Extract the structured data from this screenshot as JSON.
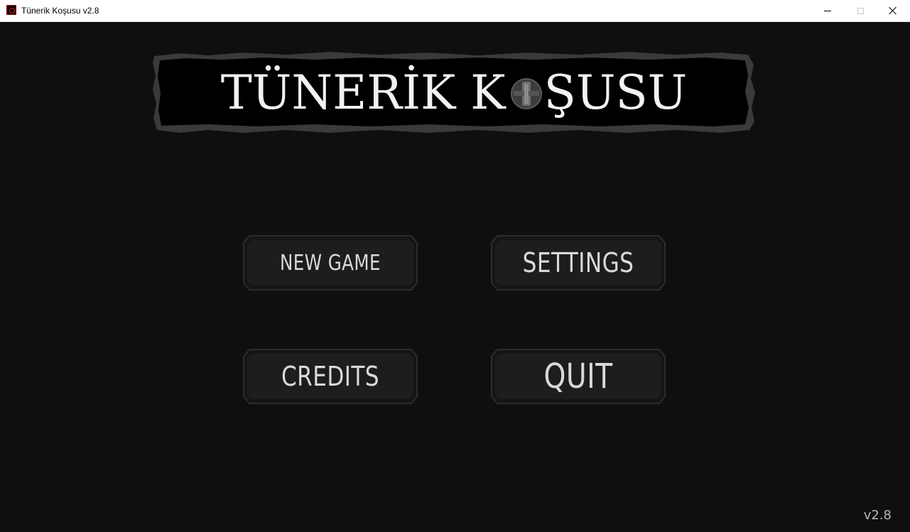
{
  "window": {
    "title": "Tünerik Koşusu v2.8",
    "icon": "game-app-icon",
    "controls": [
      "minimize",
      "maximize",
      "close"
    ]
  },
  "logo": {
    "title_part1": "TÜNERİK K",
    "title_part2": "ŞUSU",
    "emblem_icon": "shield-emblem-icon"
  },
  "menu": {
    "new_game": "NEW GAME",
    "settings": "SETTINGS",
    "credits": "CREDITS",
    "quit": "QUIT"
  },
  "version": "v2.8",
  "colors": {
    "background": "#0f0f0f",
    "button_face": "#1c1c1c",
    "button_border": "#2f2f2f",
    "text": "#d9d9d9"
  }
}
